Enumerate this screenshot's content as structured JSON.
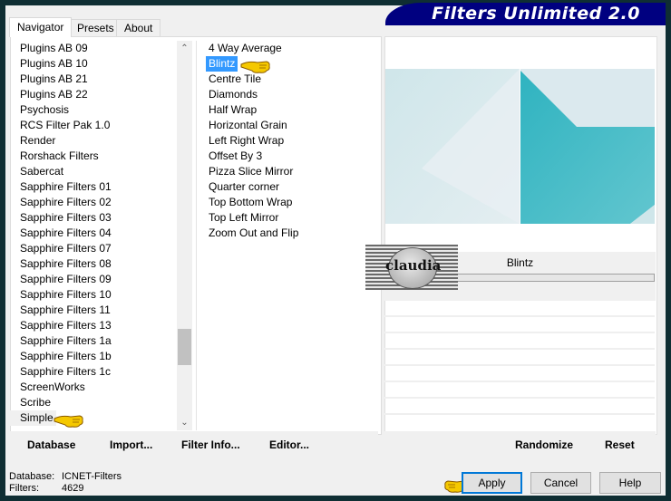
{
  "header": {
    "title": "Filters Unlimited 2.0"
  },
  "tabs": [
    {
      "label": "Navigator",
      "active": true
    },
    {
      "label": "Presets",
      "active": false
    },
    {
      "label": "About",
      "active": false
    }
  ],
  "categories": {
    "items": [
      "Plugins AB 09",
      "Plugins AB 10",
      "Plugins AB 21",
      "Plugins AB 22",
      "Psychosis",
      "RCS Filter Pak 1.0",
      "Render",
      "Rorshack Filters",
      "Sabercat",
      "Sapphire Filters 01",
      "Sapphire Filters 02",
      "Sapphire Filters 03",
      "Sapphire Filters 04",
      "Sapphire Filters 07",
      "Sapphire Filters 08",
      "Sapphire Filters 09",
      "Sapphire Filters 10",
      "Sapphire Filters 11",
      "Sapphire Filters 13",
      "Sapphire Filters 1a",
      "Sapphire Filters 1b",
      "Sapphire Filters 1c",
      "ScreenWorks",
      "Scribe",
      "Simple"
    ],
    "selected": "Simple"
  },
  "filters": {
    "items": [
      "4 Way Average",
      "Blintz",
      "Centre Tile",
      "Diamonds",
      "Half Wrap",
      "Horizontal Grain",
      "Left Right Wrap",
      "Offset By 3",
      "Pizza Slice Mirror",
      "Quarter corner",
      "Top Bottom Wrap",
      "Top Left Mirror",
      "Zoom Out and Flip"
    ],
    "selected": "Blintz"
  },
  "left_buttons": {
    "database": "Database",
    "import": "Import...",
    "filter_info": "Filter Info...",
    "editor": "Editor..."
  },
  "right_buttons": {
    "randomize": "Randomize",
    "reset": "Reset"
  },
  "control": {
    "filter_name": "Blintz"
  },
  "watermark": {
    "text": "claudia"
  },
  "status": {
    "database_label": "Database:",
    "database_value": "ICNET-Filters",
    "filters_label": "Filters:",
    "filters_value": "4629"
  },
  "dialog_buttons": {
    "apply": "Apply",
    "cancel": "Cancel",
    "help": "Help"
  },
  "colors": {
    "banner": "#000080",
    "selection": "#3399ff",
    "preview_teal": "#2fb3c0",
    "preview_light": "#cfe8ec"
  }
}
